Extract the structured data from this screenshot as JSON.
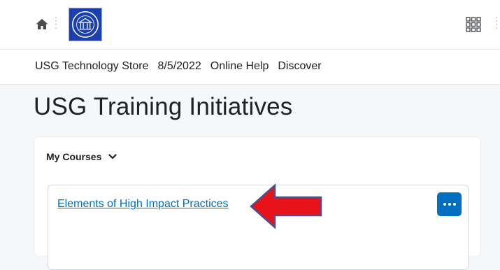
{
  "topbar": {
    "home_icon": "home-icon",
    "logo": "institution-seal-logo",
    "apps_icon": "waffle-grid-icon"
  },
  "nav": {
    "items": [
      "USG Technology Store",
      "8/5/2022",
      "Online Help",
      "Discover"
    ]
  },
  "page": {
    "title": "USG Training Initiatives"
  },
  "widget": {
    "header_label": "My Courses",
    "header_icon": "chevron-down-icon",
    "course": {
      "title": "Elements of High Impact Practices",
      "menu_icon": "more-options-icon"
    }
  },
  "annotation": {
    "icon": "red-arrow-icon",
    "color": "#e8121a"
  },
  "colors": {
    "link": "#006fbf",
    "logo_bg": "#1c3fb0",
    "button_bg": "#006fbf"
  }
}
